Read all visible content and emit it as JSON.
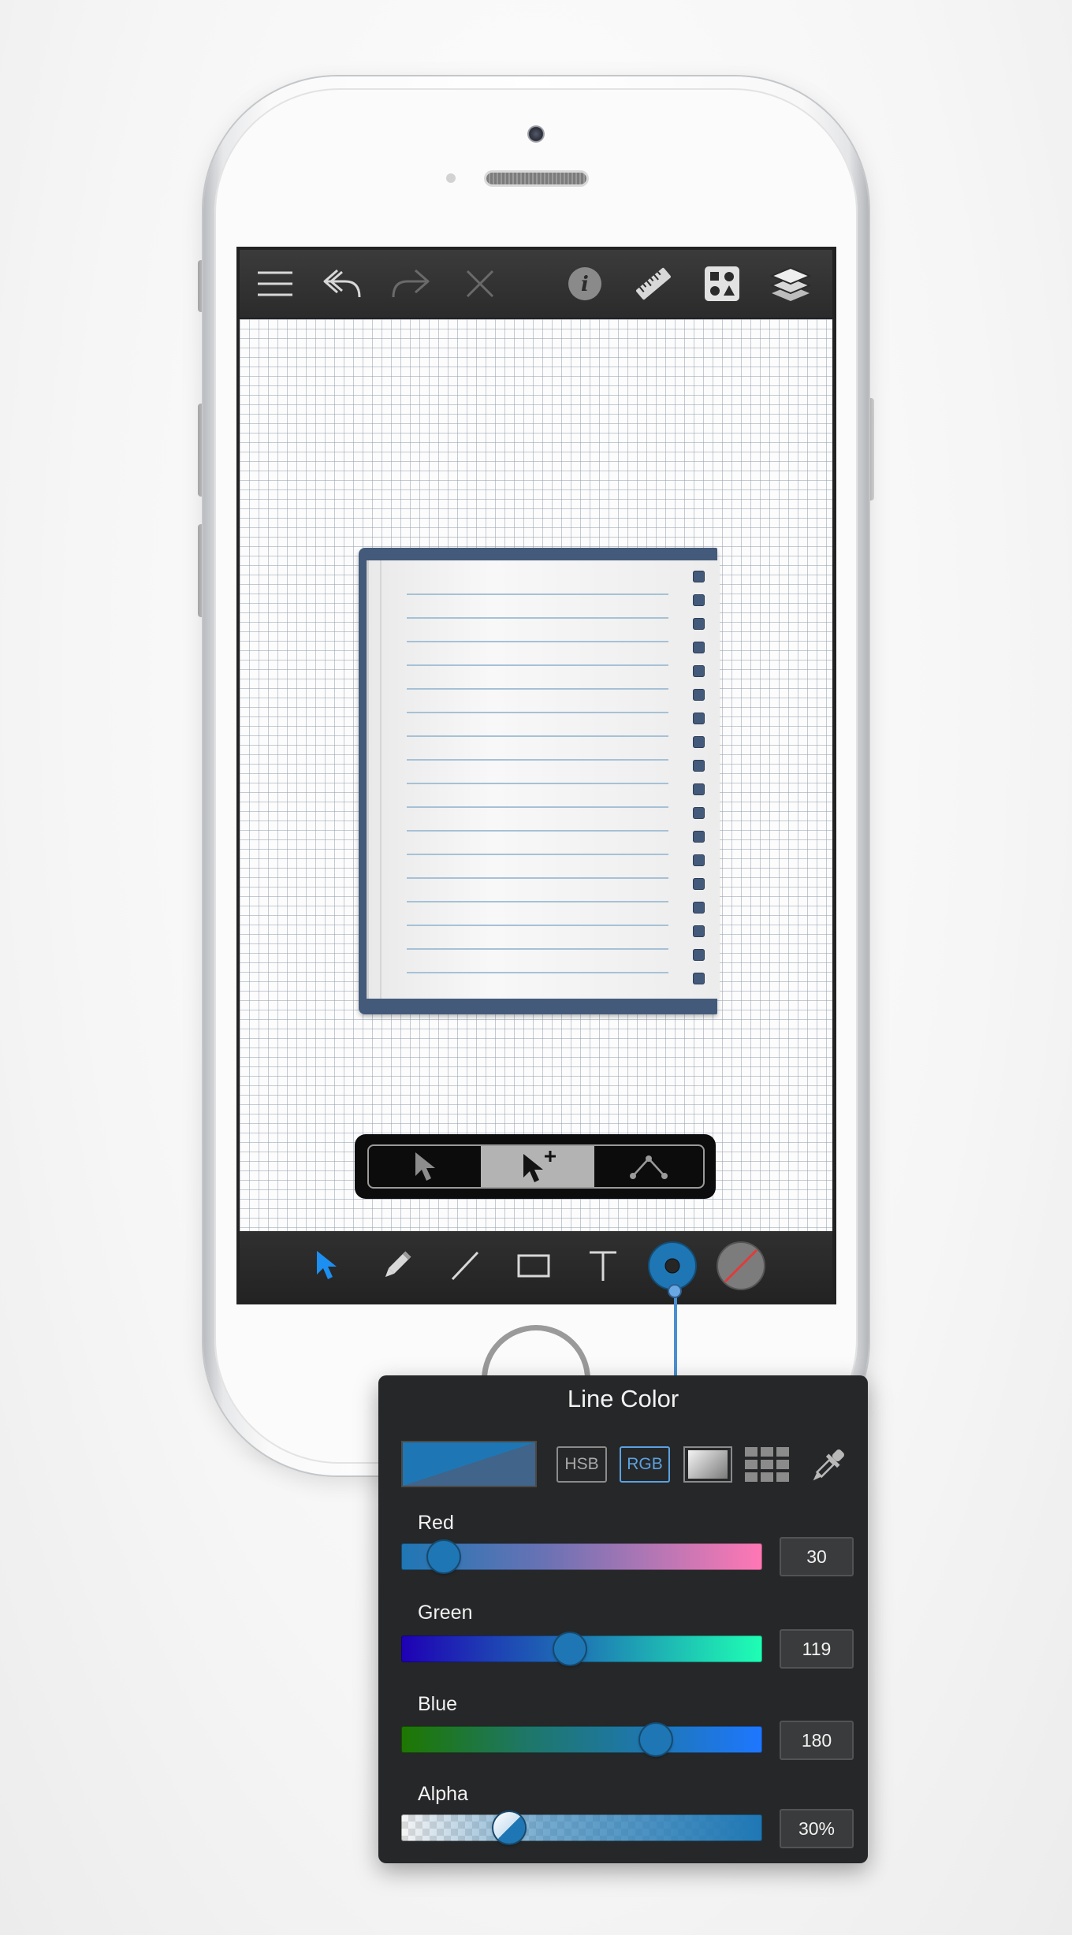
{
  "toolbar": {
    "icons": [
      "menu-icon",
      "undo-icon",
      "redo-icon",
      "close-icon",
      "info-icon",
      "ruler-icon",
      "shapes-library-icon",
      "layers-icon"
    ]
  },
  "selection_modes": {
    "items": [
      "select-arrow-icon",
      "select-add-arrow-icon",
      "edit-points-icon"
    ],
    "active": "select-add-arrow-icon"
  },
  "tools": {
    "items": [
      "pointer-tool-icon",
      "pencil-tool-icon",
      "line-tool-icon",
      "rectangle-tool-icon",
      "text-tool-icon",
      "line-color-icon",
      "fill-color-icon"
    ],
    "active": "pointer-tool-icon"
  },
  "color_panel": {
    "title": "Line Color",
    "modes": {
      "hsb": "HSB",
      "rgb": "RGB"
    },
    "active_mode": "RGB",
    "current_color": "#1e77b4",
    "previous_color": "#40648a",
    "sliders": {
      "red": {
        "label": "Red",
        "value": "30",
        "fraction": 0.118
      },
      "green": {
        "label": "Green",
        "value": "119",
        "fraction": 0.467
      },
      "blue": {
        "label": "Blue",
        "value": "180",
        "fraction": 0.706
      },
      "alpha": {
        "label": "Alpha",
        "value": "30%",
        "fraction": 0.3
      }
    }
  },
  "colors": {
    "accent": "#1e77b4",
    "toolbar_bg": "#2b2b2b",
    "notebook_cover": "#445a7b",
    "active_tool": "#1d8ff0"
  }
}
